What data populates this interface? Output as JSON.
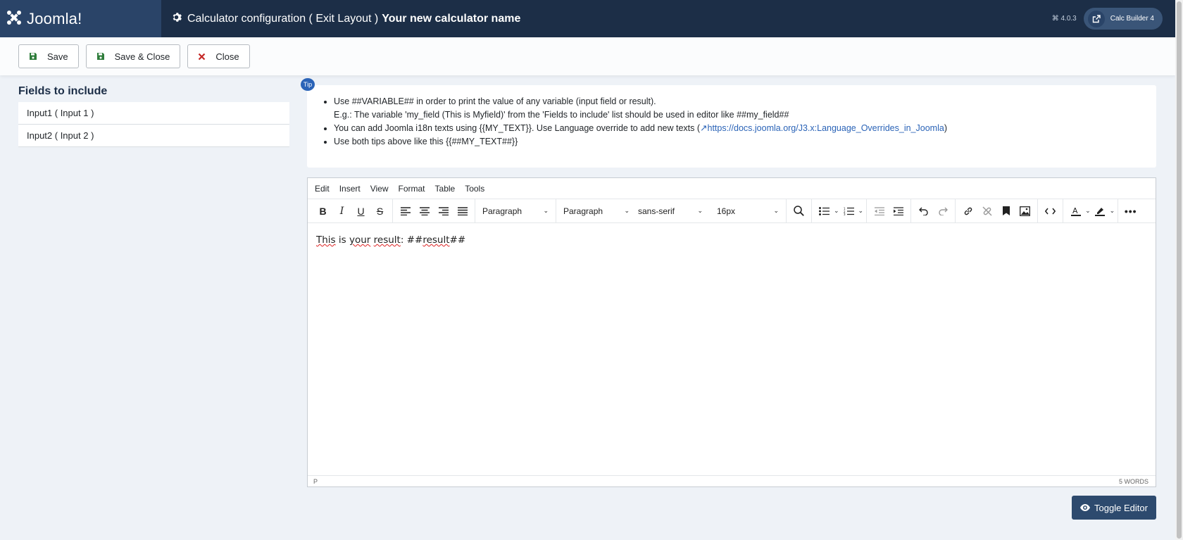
{
  "header": {
    "brand": "Joomla!",
    "page_title": "Calculator configuration ( Exit Layout )",
    "calc_name": "Your new calculator name",
    "version": "4.0.3",
    "user_label": "Calc Builder 4"
  },
  "toolbar": {
    "save_label": "Save",
    "save_close_label": "Save & Close",
    "close_label": "Close"
  },
  "fields": {
    "title": "Fields to include",
    "items": [
      {
        "label": "Input1 ( Input 1 )"
      },
      {
        "label": "Input2 ( Input 2 )"
      }
    ]
  },
  "tip": {
    "badge": "Tip",
    "line1": "Use ##VARIABLE## in order to print the value of any variable (input field or result).",
    "line1b": "E.g.: The variable 'my_field (This is Myfield)' from the 'Fields to include' list should be used in editor like ##my_field##",
    "line2_prefix": "You can add Joomla i18n texts using {{MY_TEXT}}. Use Language override to add new texts (",
    "line2_link": "https://docs.joomla.org/J3.x:Language_Overrides_in_Joomla",
    "line2_suffix": ")",
    "line3": "Use both tips above like this {{##MY_TEXT##}}"
  },
  "editor": {
    "menu": [
      "Edit",
      "Insert",
      "View",
      "Format",
      "Table",
      "Tools"
    ],
    "block_format": "Paragraph",
    "style_format": "Paragraph",
    "font_family": "sans-serif",
    "font_size": "16px",
    "content": {
      "w1": "This",
      "w2": "is",
      "w3": "your",
      "w4": "result",
      "w5": ": ##",
      "w6": "result",
      "w7": "##"
    },
    "status_path": "P",
    "word_count": "5 WORDS"
  },
  "toggle_editor_label": "Toggle Editor",
  "colors": {
    "header_bg": "#1c2e47",
    "brand_bg": "#2a4468",
    "accent": "#2a63b7",
    "save_icon": "#2f7d3b",
    "close_icon": "#c52827"
  }
}
